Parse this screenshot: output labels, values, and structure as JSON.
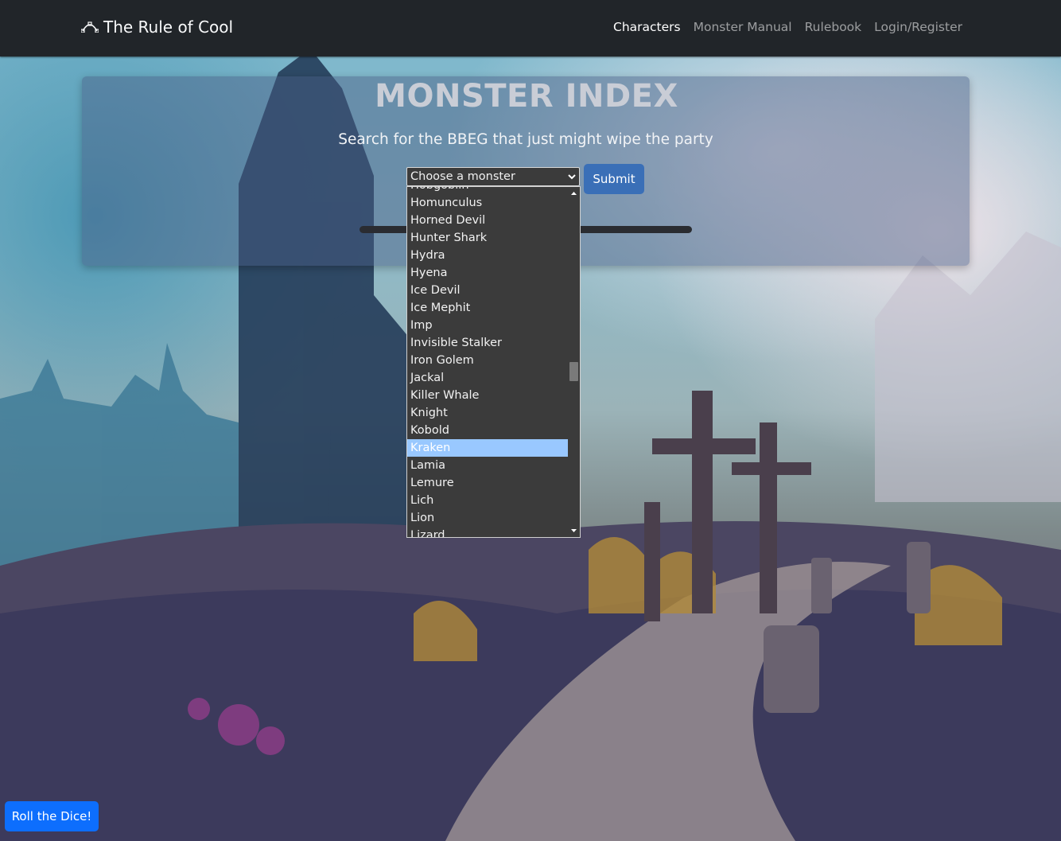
{
  "brand": {
    "name": "The Rule of Cool",
    "icon": "bezier-curve-icon"
  },
  "nav": {
    "items": [
      {
        "label": "Characters",
        "active": true
      },
      {
        "label": "Monster Manual",
        "active": false
      },
      {
        "label": "Rulebook",
        "active": false
      },
      {
        "label": "Login/Register",
        "active": false
      }
    ]
  },
  "hero": {
    "title": "MONSTER INDEX",
    "subtitle": "Search for the BBEG that just might wipe the party"
  },
  "search": {
    "select_value": "Choose a monster",
    "submit_label": "Submit",
    "options": [
      "Hobgoblin",
      "Homunculus",
      "Horned Devil",
      "Hunter Shark",
      "Hydra",
      "Hyena",
      "Ice Devil",
      "Ice Mephit",
      "Imp",
      "Invisible Stalker",
      "Iron Golem",
      "Jackal",
      "Killer Whale",
      "Knight",
      "Kobold",
      "Kraken",
      "Lamia",
      "Lemure",
      "Lich",
      "Lion",
      "Lizard"
    ],
    "highlighted_option": "Kraken"
  },
  "footer": {
    "roll_label": "Roll the Dice!"
  },
  "colors": {
    "navbar": "#212529",
    "accent": "#0d6efd",
    "submit": "#3a6fb7",
    "highlight": "#99c8ff"
  }
}
